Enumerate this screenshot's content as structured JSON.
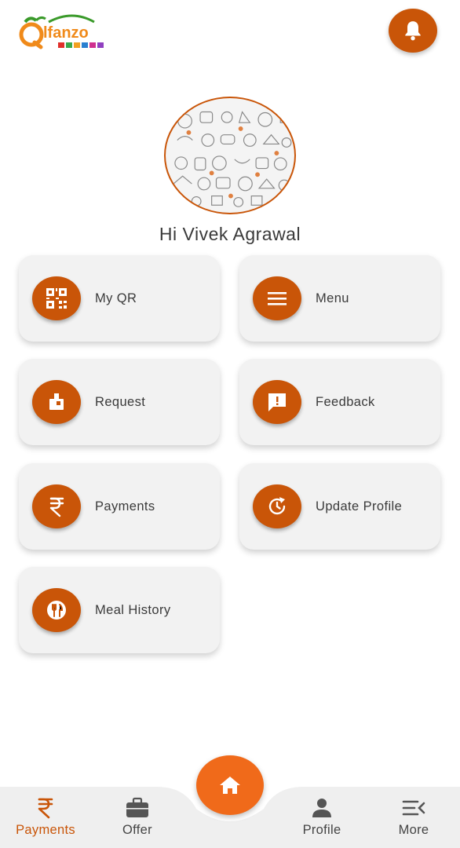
{
  "header": {
    "logo_text": "lfanzo",
    "notifications_icon": "bell-icon"
  },
  "profile": {
    "greeting": "Hi Vivek Agrawal"
  },
  "tiles": [
    {
      "label": "My QR",
      "icon": "qr-code-icon"
    },
    {
      "label": "Menu",
      "icon": "menu-lines-icon"
    },
    {
      "label": "Request",
      "icon": "request-icon"
    },
    {
      "label": "Feedback",
      "icon": "feedback-icon"
    },
    {
      "label": "Payments",
      "icon": "rupee-icon"
    },
    {
      "label": "Update Profile",
      "icon": "refresh-clock-icon"
    },
    {
      "label": "Meal History",
      "icon": "cutlery-icon"
    }
  ],
  "bottom_nav": {
    "items": [
      {
        "label": "Payments",
        "icon": "rupee-icon",
        "active": true
      },
      {
        "label": "Offer",
        "icon": "briefcase-icon",
        "active": false
      },
      {
        "label": "Profile",
        "icon": "person-icon",
        "active": false
      },
      {
        "label": "More",
        "icon": "more-menu-icon",
        "active": false
      }
    ],
    "home_icon": "home-icon"
  },
  "colors": {
    "accent": "#c95508",
    "fab": "#f06a1a",
    "tile_bg": "#f2f2f2",
    "nav_bg": "#efefef"
  }
}
